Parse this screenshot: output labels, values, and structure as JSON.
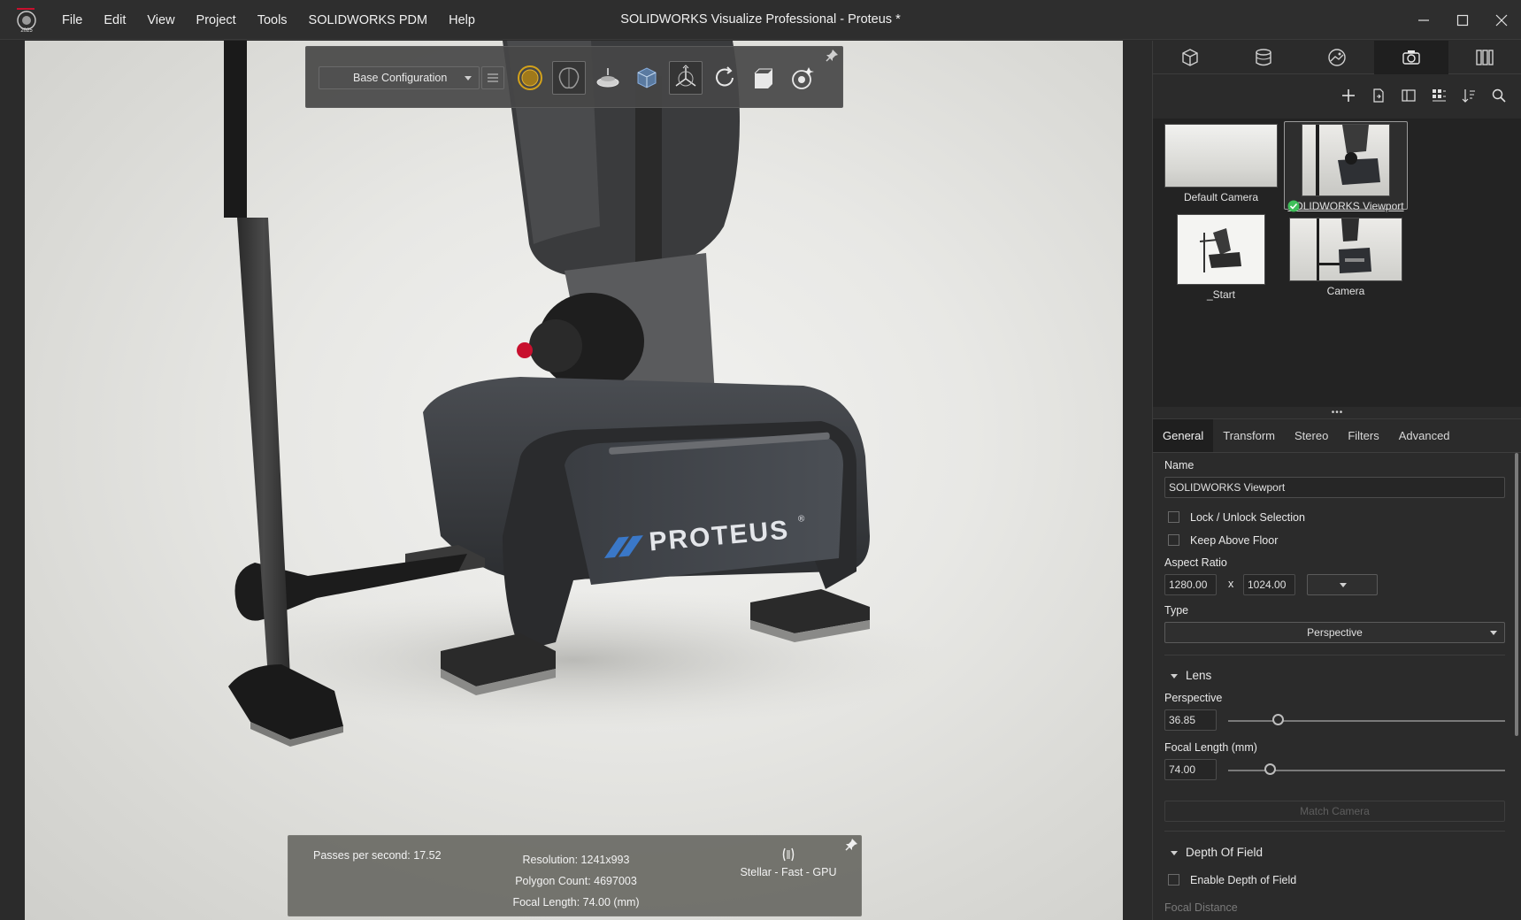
{
  "app": {
    "logo_year": "2025",
    "window_title": "SOLIDWORKS Visualize Professional - Proteus *"
  },
  "menu": {
    "items": [
      "File",
      "Edit",
      "View",
      "Project",
      "Tools",
      "SOLIDWORKS PDM",
      "Help"
    ]
  },
  "toolbar": {
    "configuration": "Base Configuration",
    "icons": [
      "render-mode-icon",
      "ai-denoiser-icon",
      "turntable-icon",
      "scene-bounds-icon",
      "object-manipulation-icon",
      "refresh-icon",
      "export-icon",
      "render-options-icon"
    ]
  },
  "viewport": {
    "brand_text": "PROTEUS",
    "brand_mark": "®"
  },
  "status": {
    "passes": "Passes per second: 17.52",
    "resolution": "Resolution: 1241x993",
    "polygons": "Polygon Count: 4697003",
    "focal": "Focal Length: 74.00 (mm)",
    "renderer": "Stellar - Fast - GPU"
  },
  "panel": {
    "tabs": [
      "models-icon",
      "appearances-icon",
      "scenes-icon",
      "cameras-icon",
      "libraries-icon"
    ],
    "tools": [
      "add-icon",
      "import-icon",
      "layout-icon",
      "grid-icon",
      "sort-icon",
      "search-icon"
    ],
    "cameras": [
      {
        "label": "Default Camera"
      },
      {
        "label": "SOLIDWORKS Viewport"
      },
      {
        "label": "_Start"
      },
      {
        "label": "Camera"
      }
    ],
    "splitter": "•••",
    "prop_tabs": [
      "General",
      "Transform",
      "Stereo",
      "Filters",
      "Advanced"
    ],
    "general": {
      "name_label": "Name",
      "name_value": "SOLIDWORKS Viewport",
      "lock_label": "Lock / Unlock Selection",
      "floor_label": "Keep Above Floor",
      "aspect_label": "Aspect Ratio",
      "aspect_w": "1280.00",
      "aspect_sep": "x",
      "aspect_h": "1024.00",
      "type_label": "Type",
      "type_value": "Perspective",
      "lens_label": "Lens",
      "perspective_label": "Perspective",
      "perspective_value": "36.85",
      "focal_label": "Focal Length (mm)",
      "focal_value": "74.00",
      "match_camera": "Match Camera",
      "dof_label": "Depth Of Field",
      "dof_enable": "Enable Depth of Field",
      "focal_distance": "Focal Distance"
    }
  },
  "colors": {
    "accent_yellow": "#d4a21a",
    "check_green": "#3fbf5a",
    "logo_blue": "#3a78c8"
  }
}
